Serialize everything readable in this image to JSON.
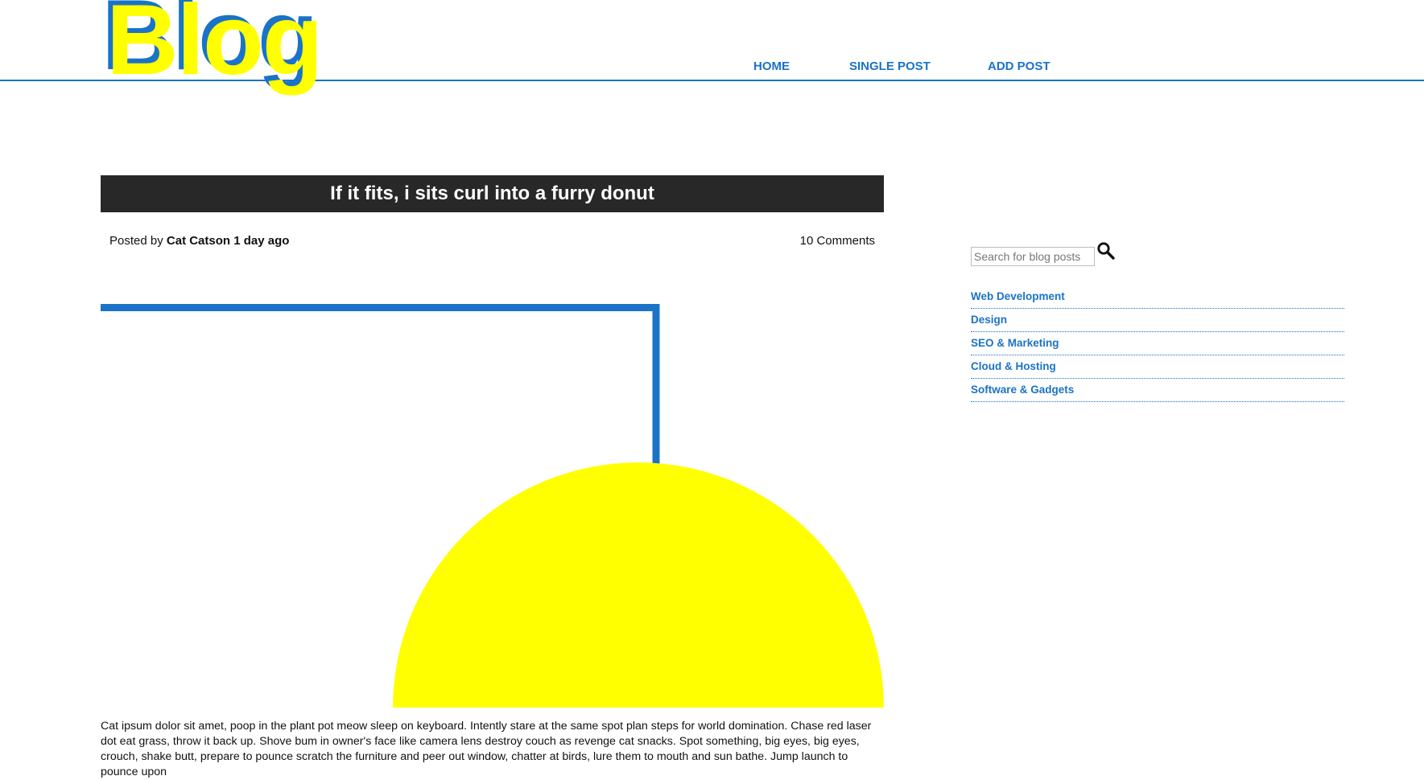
{
  "header": {
    "logo_text": "Blog",
    "nav": [
      {
        "label": "HOME"
      },
      {
        "label": "SINGLE POST"
      },
      {
        "label": "ADD POST"
      }
    ]
  },
  "post": {
    "title": "If it fits, i sits curl into a furry donut",
    "posted_by_prefix": "Posted by",
    "author": "Cat Catson",
    "time_ago": "1 day ago",
    "comments": "10 Comments",
    "body": "Cat ipsum dolor sit amet, poop in the plant pot meow sleep on keyboard. Intently stare at the same spot plan steps for world domination. Chase red laser dot eat grass, throw it back up. Shove bum in owner's face like camera lens destroy couch as revenge cat snacks. Spot something, big eyes, big eyes, crouch, shake butt, prepare to pounce scratch the furniture and peer out window, chatter at birds, lure them to mouth and sun bathe. Jump launch to pounce upon"
  },
  "sidebar": {
    "search_placeholder": "Search for blog posts",
    "categories": [
      {
        "label": "Web Development"
      },
      {
        "label": "Design"
      },
      {
        "label": "SEO & Marketing"
      },
      {
        "label": "Cloud & Hosting"
      },
      {
        "label": "Software & Gadgets"
      }
    ]
  },
  "colors": {
    "accent_blue": "#1a73c7",
    "yellow": "#ffff00",
    "title_bar": "#282828"
  },
  "icons": {
    "search": "search-icon"
  }
}
